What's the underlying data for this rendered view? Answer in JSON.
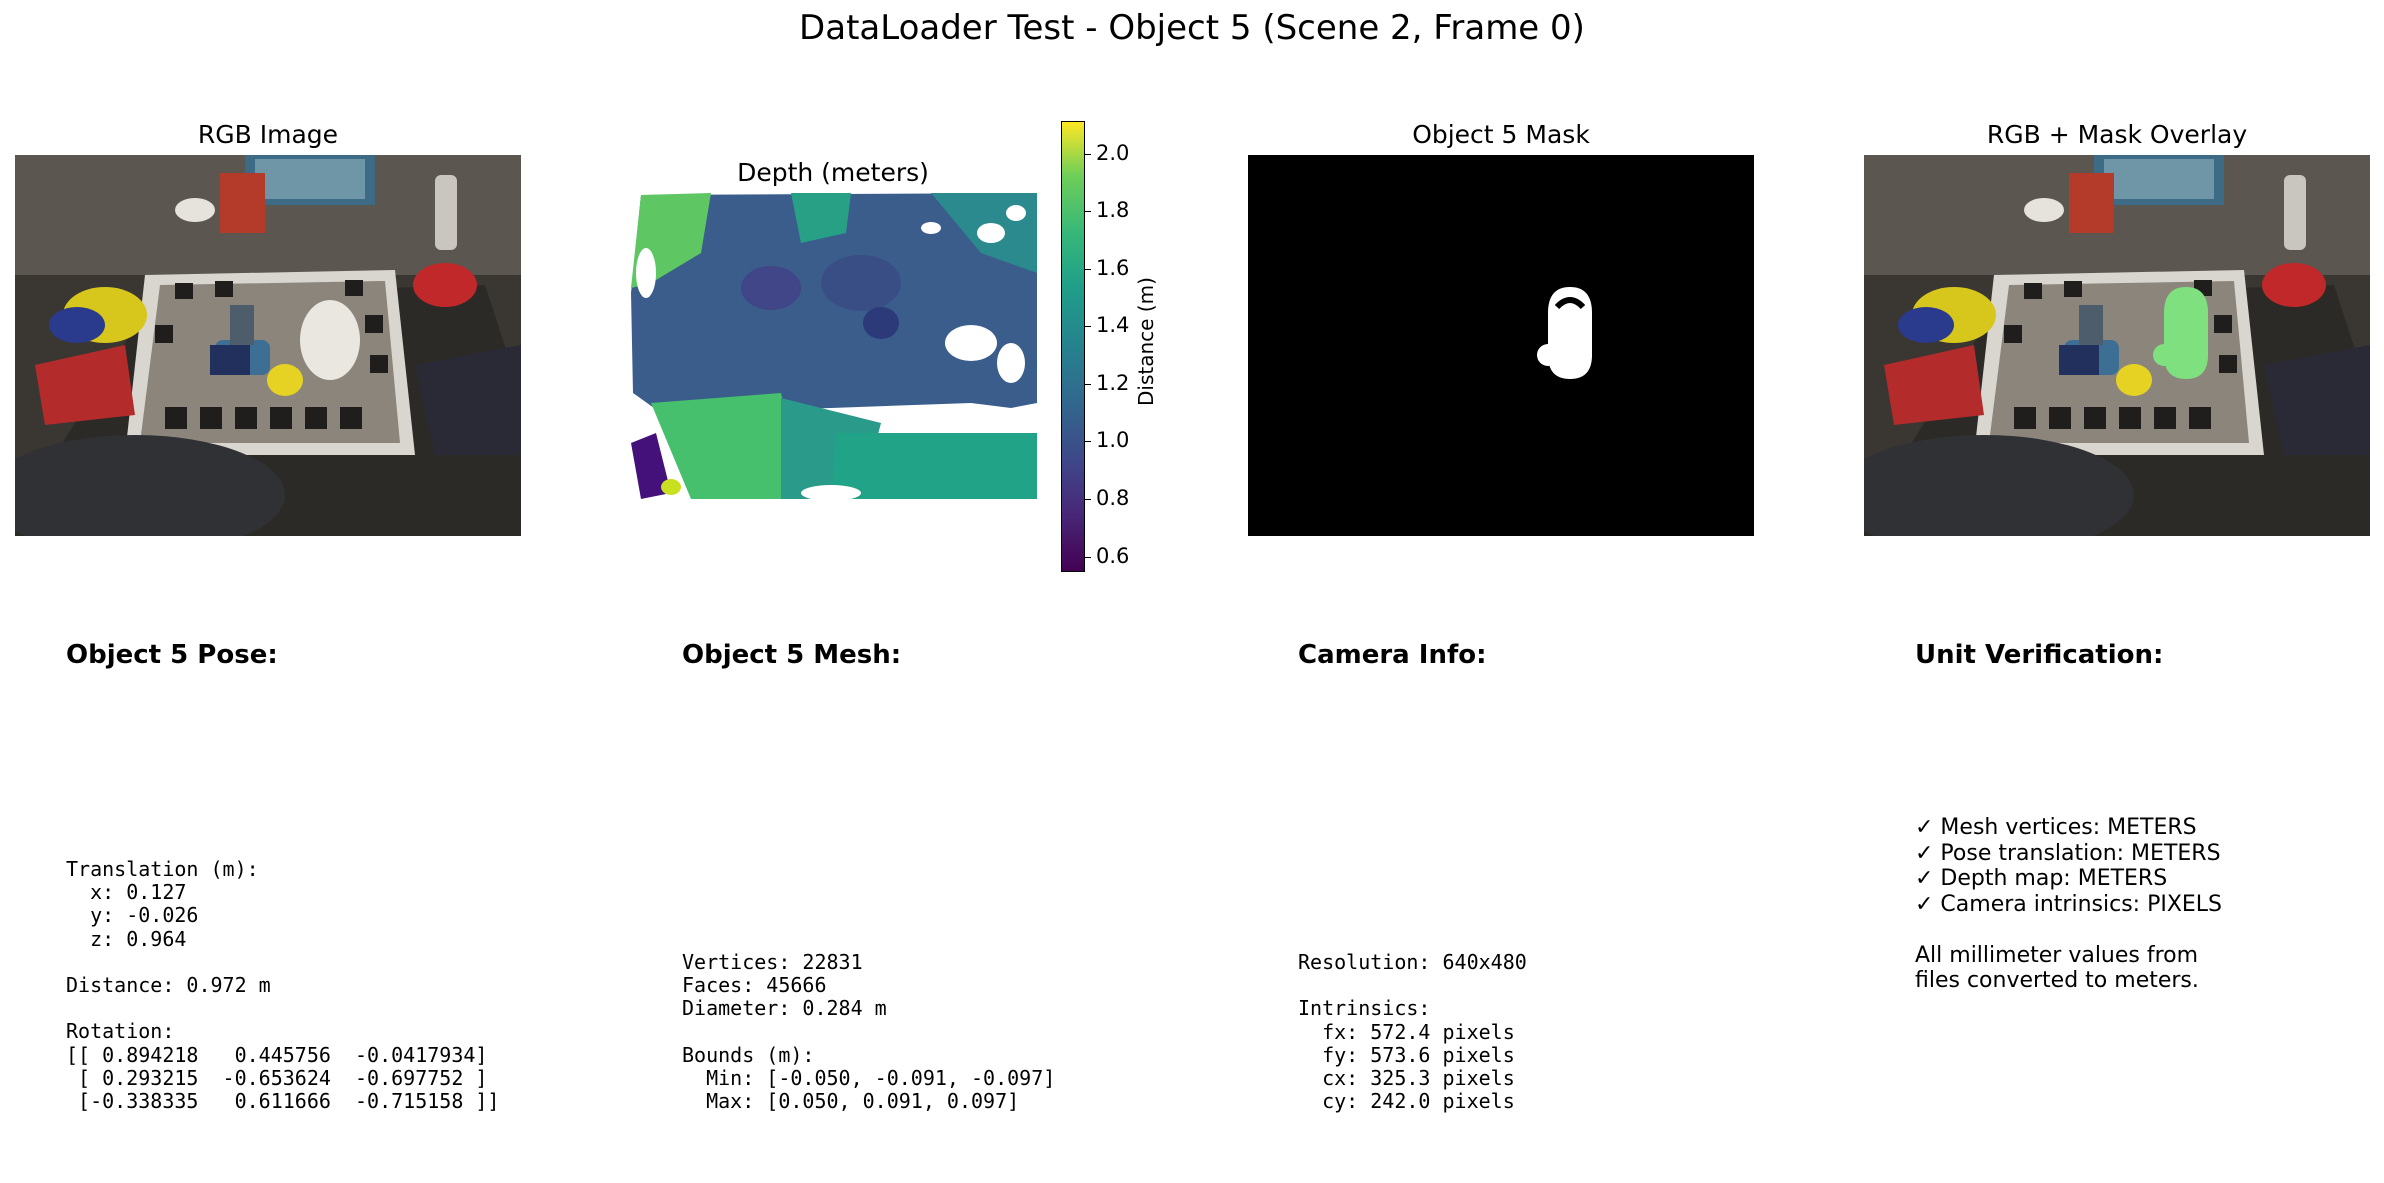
{
  "figure": {
    "title": "DataLoader Test - Object 5 (Scene 2, Frame 0)"
  },
  "panels": {
    "rgb": {
      "title": "RGB Image"
    },
    "depth": {
      "title": "Depth (meters)"
    },
    "mask": {
      "title": "Object 5 Mask"
    },
    "overlay": {
      "title": "RGB + Mask Overlay"
    }
  },
  "colorbar": {
    "label": "Distance (m)",
    "colormap": "viridis",
    "min": 0.55,
    "max": 2.11,
    "ticks": [
      "2.0",
      "1.8",
      "1.6",
      "1.4",
      "1.2",
      "1.0",
      "0.8",
      "0.6"
    ],
    "tick_values": [
      2.0,
      1.8,
      1.6,
      1.4,
      1.2,
      1.0,
      0.8,
      0.6
    ]
  },
  "info": {
    "pose": {
      "heading": "Object 5 Pose:",
      "body": "Translation (m):\n  x: 0.127\n  y: -0.026\n  z: 0.964\n\nDistance: 0.972 m\n\nRotation:\n[[ 0.894218   0.445756  -0.0417934]\n [ 0.293215  -0.653624  -0.697752 ]\n [-0.338335   0.611666  -0.715158 ]]"
    },
    "mesh": {
      "heading": "Object 5 Mesh:",
      "body": "Vertices: 22831\nFaces: 45666\nDiameter: 0.284 m\n\nBounds (m):\n  Min: [-0.050, -0.091, -0.097]\n  Max: [0.050, 0.091, 0.097]"
    },
    "camera": {
      "heading": "Camera Info:",
      "body": "Resolution: 640x480\n\nIntrinsics:\n  fx: 572.4 pixels\n  fy: 573.6 pixels\n  cx: 325.3 pixels\n  cy: 242.0 pixels"
    },
    "units": {
      "heading": "Unit Verification:",
      "body": "✓ Mesh vertices: METERS\n✓ Pose translation: METERS\n✓ Depth map: METERS\n✓ Camera intrinsics: PIXELS\n\nAll millimeter values from\nfiles converted to meters."
    }
  },
  "colors": {
    "mask_fill": "#000000",
    "mask_object": "#ffffff",
    "overlay_highlight": "#7fe07f"
  }
}
